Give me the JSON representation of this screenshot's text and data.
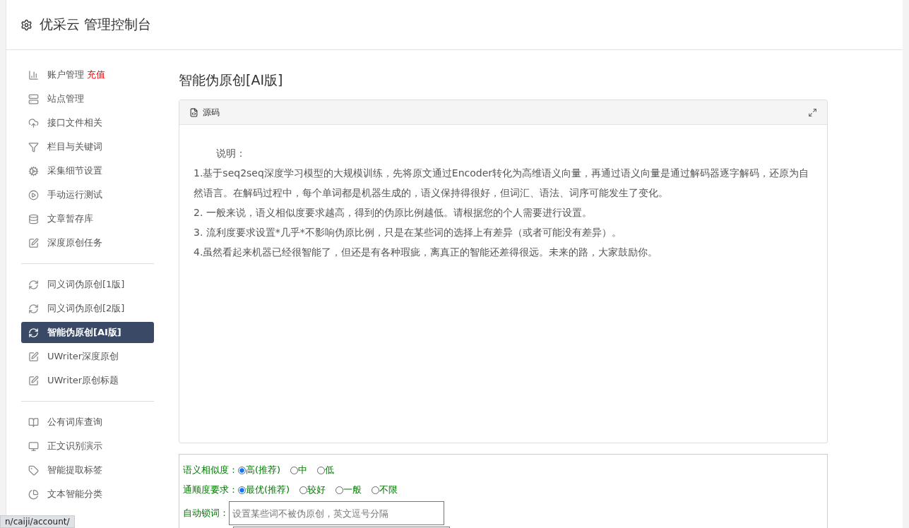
{
  "header": {
    "title": "优采云 管理控制台"
  },
  "sidebar": {
    "groups": [
      [
        {
          "label": "账户管理",
          "badge": "充值",
          "selected": false
        },
        {
          "label": "站点管理",
          "selected": false
        },
        {
          "label": "接口文件相关",
          "selected": false
        },
        {
          "label": "栏目与关键词",
          "selected": false
        },
        {
          "label": "采集细节设置",
          "selected": false
        },
        {
          "label": "手动运行测试",
          "selected": false
        },
        {
          "label": "文章暂存库",
          "selected": false
        },
        {
          "label": "深度原创任务",
          "selected": false
        }
      ],
      [
        {
          "label": "同义词伪原创[1版]",
          "selected": false
        },
        {
          "label": "同义词伪原创[2版]",
          "selected": false
        },
        {
          "label": "智能伪原创[AI版]",
          "selected": true
        },
        {
          "label": "UWriter深度原创",
          "selected": false
        },
        {
          "label": "UWriter原创标题",
          "selected": false
        }
      ],
      [
        {
          "label": "公有词库查询",
          "selected": false
        },
        {
          "label": "正文识别演示",
          "selected": false
        },
        {
          "label": "智能提取标签",
          "selected": false
        },
        {
          "label": "文本智能分类",
          "selected": false
        }
      ]
    ]
  },
  "page_title": "智能伪原创[AI版]",
  "editor": {
    "tab": "源码",
    "heading": "说明：",
    "paragraphs": [
      "1.基于seq2seq深度学习模型的大规模训练，先将原文通过Encoder转化为高维语义向量，再通过语义向量是通过解码器逐字解码，还原为自然语言。在解码过程中，每个单词都是机器生成的，语义保持得很好，但词汇、语法、词序可能发生了变化。",
      "2. 一般来说，语义相似度要求越高，得到的伪原比例越低。请根据您的个人需要进行设置。",
      "3. 流利度要求设置*几乎*不影响伪原比例，只是在某些词的选择上有差异（或者可能没有差异）。",
      "4.虽然看起来机器已经很智能了，但还是有各种瑕疵，离真正的智能还差得很远。未来的路，大家鼓励你。"
    ]
  },
  "form": {
    "radio_groups": [
      {
        "label": "语义相似度：",
        "options": [
          {
            "label": "高(推荐)",
            "selected": true
          },
          {
            "label": "中",
            "selected": false
          },
          {
            "label": "低",
            "selected": false
          }
        ]
      },
      {
        "label": "通顺度要求：",
        "options": [
          {
            "label": "最优(推荐)",
            "selected": true
          },
          {
            "label": "较好",
            "selected": false
          },
          {
            "label": "一般",
            "selected": false
          },
          {
            "label": "不限",
            "selected": false
          }
        ]
      }
    ],
    "lock_words": {
      "label": "自动锁词：",
      "placeholder": "设置某些词不被伪原创，英文逗号分隔"
    }
  },
  "status_url": "n/caiji/account/"
}
